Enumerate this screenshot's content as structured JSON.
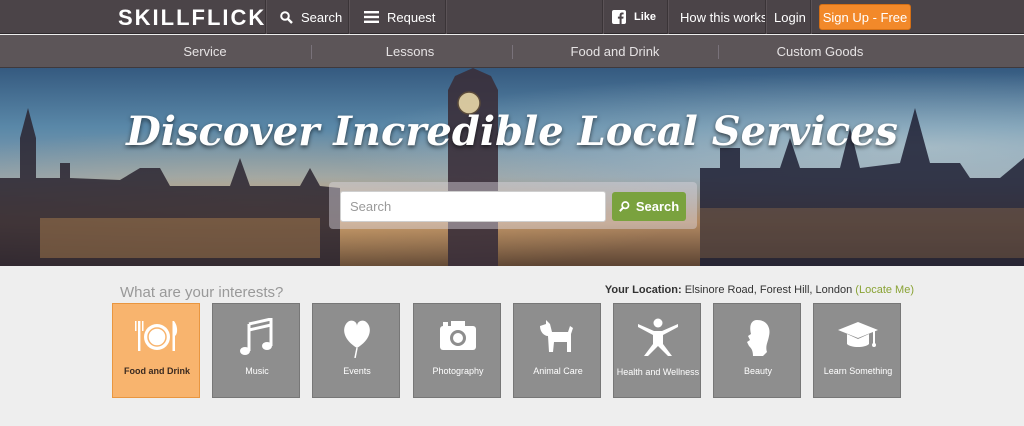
{
  "topbar": {
    "logo": "SKILLFLICK",
    "search_label": "Search",
    "request_label": "Request",
    "like_label": "Like",
    "how_label": "How this works",
    "login_label": "Login",
    "signup_label": "Sign Up - Free"
  },
  "categories": [
    "Service",
    "Lessons",
    "Food and Drink",
    "Custom Goods"
  ],
  "hero": {
    "headline": "Discover Incredible Local Services",
    "search_placeholder": "Search",
    "search_button": "Search"
  },
  "interests": {
    "title": "What are your interests?",
    "location_label": "Your Location:",
    "location_value": "Elsinore Road, Forest Hill, London",
    "locate_me": "(Locate Me)",
    "tiles": [
      {
        "label": "Food and Drink",
        "icon": "plate-cutlery-icon",
        "selected": true
      },
      {
        "label": "Music",
        "icon": "music-note-icon"
      },
      {
        "label": "Events",
        "icon": "balloon-icon"
      },
      {
        "label": "Photography",
        "icon": "camera-icon"
      },
      {
        "label": "Animal Care",
        "icon": "dog-icon"
      },
      {
        "label": "Health and Wellness",
        "icon": "yoga-figure-icon"
      },
      {
        "label": "Beauty",
        "icon": "woman-silhouette-icon"
      },
      {
        "label": "Learn Something",
        "icon": "graduation-cap-icon"
      }
    ]
  },
  "colors": {
    "topbar": "#4b4448",
    "accent_orange": "#f2892a",
    "search_green": "#7aa23e",
    "tile_grey": "#8e8e8e",
    "tile_selected": "#f8b46e"
  }
}
